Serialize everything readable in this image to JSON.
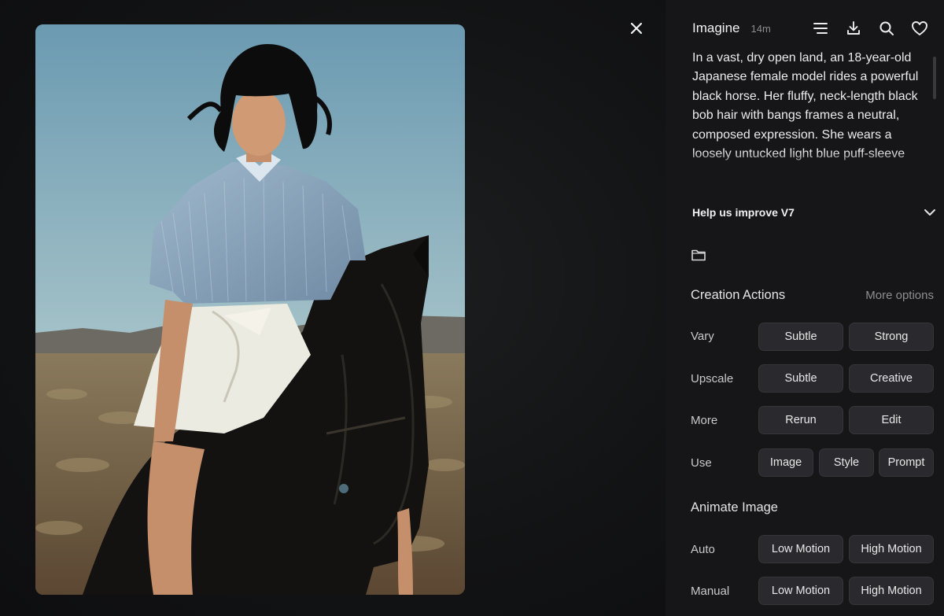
{
  "header": {
    "app_title": "Imagine",
    "age": "14m",
    "icons": [
      "menu-icon",
      "download-icon",
      "search-icon",
      "heart-icon"
    ]
  },
  "viewer": {
    "close_icon": "close-icon"
  },
  "prompt": {
    "text": "In a vast, dry open land, an 18-year-old Japanese female model rides a powerful black horse. Her fluffy, neck-length black bob hair with bangs frames a neutral, composed expression. She wears a loosely untucked light blue puff-sleeve"
  },
  "help": {
    "label": "Help us improve V7",
    "icon": "chevron-down-icon"
  },
  "folder": {
    "icon": "folder-icon"
  },
  "creation_actions": {
    "title": "Creation Actions",
    "more_options": "More options",
    "rows": [
      {
        "label": "Vary",
        "buttons": [
          "Subtle",
          "Strong"
        ]
      },
      {
        "label": "Upscale",
        "buttons": [
          "Subtle",
          "Creative"
        ]
      },
      {
        "label": "More",
        "buttons": [
          "Rerun",
          "Edit"
        ]
      },
      {
        "label": "Use",
        "buttons": [
          "Image",
          "Style",
          "Prompt"
        ]
      }
    ]
  },
  "animate": {
    "title": "Animate Image",
    "rows": [
      {
        "label": "Auto",
        "buttons": [
          "Low Motion",
          "High Motion"
        ]
      },
      {
        "label": "Manual",
        "buttons": [
          "Low Motion",
          "High Motion"
        ]
      }
    ]
  },
  "colors": {
    "panel_bg": "#161618",
    "button_bg": "#2a2a2e",
    "button_border": "#35353a",
    "muted_text": "#8e8e93"
  }
}
